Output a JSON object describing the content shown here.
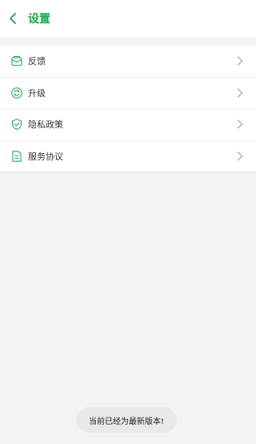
{
  "header": {
    "title": "设置",
    "back_icon": "chevron-left-icon",
    "accent": "#15a846"
  },
  "menu": [
    {
      "id": "feedback",
      "label": "反馈",
      "icon": "mail-icon"
    },
    {
      "id": "upgrade",
      "label": "升级",
      "icon": "refresh-icon"
    },
    {
      "id": "privacy",
      "label": "隐私政策",
      "icon": "shield-check-icon"
    },
    {
      "id": "terms",
      "label": "服务协议",
      "icon": "document-icon"
    }
  ],
  "toast": {
    "text": "当前已经为最新版本!"
  }
}
